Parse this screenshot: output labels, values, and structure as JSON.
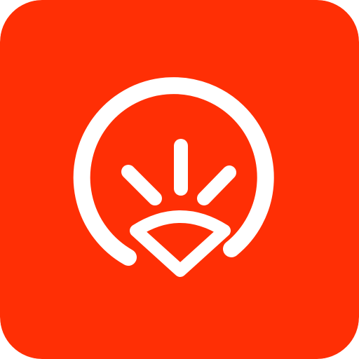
{
  "app_icon": {
    "name": "sunrise-logo-icon",
    "background_color": "#ff2f05",
    "glyph_color": "#ffffff"
  }
}
